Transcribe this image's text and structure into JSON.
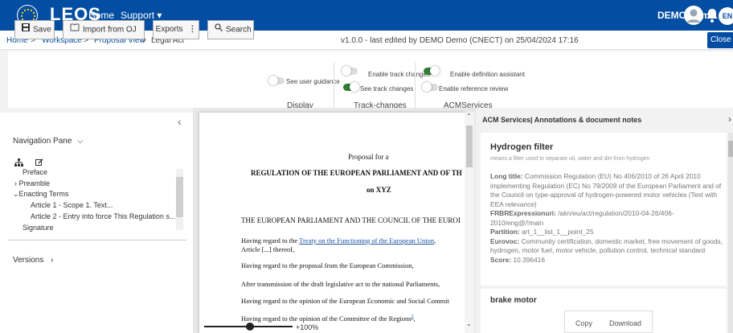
{
  "header": {
    "brand": "LEOS",
    "nav_home": "Home",
    "nav_support": "Support ▾",
    "user_name": "DEMO Demo",
    "notification_count": "0",
    "language": "EN",
    "accent_color": "#034ea2"
  },
  "breadcrumb": {
    "home": "Home",
    "workspace": "Workspace",
    "proposal_view": "Proposal View",
    "current": "Legal Act",
    "separator": ">"
  },
  "version_info": "v1.0.0 - last edited by DEMO Demo (CNECT) on 25/04/2024 17:16",
  "close_label": "Close",
  "toolbar": {
    "save": "Save",
    "import_oj": "Import from OJ",
    "exports": "Exports",
    "search": "Search",
    "user_guidance": "See user guidance",
    "enable_track_changes": "Enable track changes",
    "see_track_changes": "See track changes",
    "enable_definition_assistant": "Enable definition assistant",
    "enable_reference_review": "Enable reference review",
    "group_display": "Display",
    "group_track_changes": "Track-changes",
    "group_acm": "ACMServices",
    "toggles": {
      "user_guidance": false,
      "enable_track_changes": false,
      "see_track_changes": true,
      "enable_definition_assistant": true,
      "enable_reference_review": false
    }
  },
  "navigation": {
    "title": "Navigation Pane",
    "items": [
      {
        "label": "Preface"
      },
      {
        "label": "Preamble"
      },
      {
        "label": "Enacting Terms"
      },
      {
        "label": "Article 1 - Scope 1. Text..."
      },
      {
        "label": "Article 2 - Entry into force This Regulation s..."
      },
      {
        "label": "Signature"
      }
    ],
    "versions": "Versions"
  },
  "document": {
    "proposal_for": "Proposal for a",
    "regulation_title": "REGULATION OF THE EUROPEAN PARLIAMENT AND OF TH",
    "on": "on XYZ",
    "preamble_head": "THE EUROPEAN PARLIAMENT AND THE COUNCIL OF THE EUROI",
    "citation1_before": "Having regard to the ",
    "citation1_link": "Treaty on the Functioning of the European Union",
    "citation1_after": ",",
    "citation1_line2": "Article [...] thereof,",
    "citation2": "Having regard to the proposal from the European Commission,",
    "citation3": "After transmission of the draft legislative act to the national Parliaments,",
    "citation4": "Having regard to the opinion of the European Economic and Social Commit",
    "citation5": "Having regard to the opinion of the Committee of the Regions",
    "citation5_footnote": "2",
    "citation5_after": ",",
    "zoom": "+100%"
  },
  "acm": {
    "header": "ACM Services| Annotations & document notes",
    "card1": {
      "title": "Hydrogen filter",
      "subtitle": "means a filter used to separate oil, water and dirt from hydrogen",
      "long_title_label": "Long title:",
      "long_title": " Commission Regulation (EU) No 406/2010 of 26 April 2010 implementing Regulation (EC) No 79/2009 of the European Parliament and of the Council on type-approval of hydrogen-powered motor vehicles (Text with EEA relevance)",
      "frbr_label": "FRBRExpressionuri:",
      "frbr": " /akn/eu/act/regulation/2010-04-26/406-2010/eng@/!main",
      "partition_label": "Partition:",
      "partition": " art_1__list_1__point_25",
      "eurovoc_label": "Eurovoc:",
      "eurovoc": " Community certification, domestic market, free movement of goods, hydrogen, motor fuel, motor vehicle, pollution control, technical standard",
      "score_label": "Score:",
      "score": " 10.396416"
    },
    "card2_title": "brake motor",
    "copy": "Copy",
    "download": "Download"
  }
}
